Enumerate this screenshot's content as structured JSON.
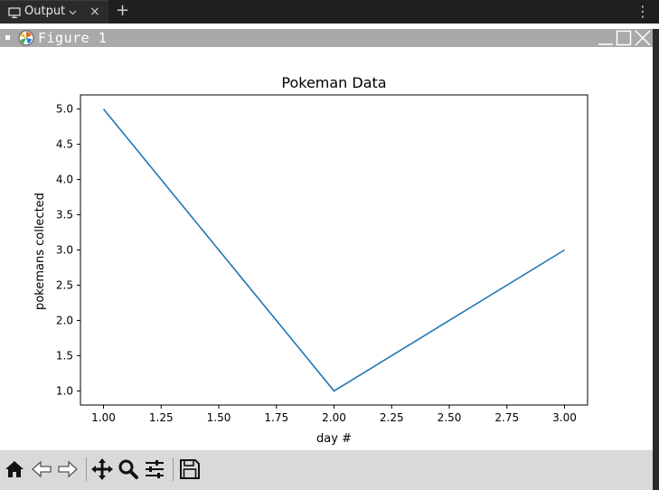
{
  "tab": {
    "label": "Output",
    "close_glyph": "×"
  },
  "tab_bar": {
    "new_tab_glyph": "+",
    "more_glyph": "⋮"
  },
  "window": {
    "title": "Figure 1"
  },
  "chart_data": {
    "type": "line",
    "title": "Pokeman Data",
    "xlabel": "day #",
    "ylabel": "pokemans collected",
    "x": [
      1,
      2,
      3
    ],
    "y": [
      5,
      1,
      3
    ],
    "xlim": [
      0.9,
      3.1
    ],
    "ylim": [
      0.8,
      5.2
    ],
    "xticks": [
      "1.00",
      "1.25",
      "1.50",
      "1.75",
      "2.00",
      "2.25",
      "2.50",
      "2.75",
      "3.00"
    ],
    "yticks": [
      "1.0",
      "1.5",
      "2.0",
      "2.5",
      "3.0",
      "3.5",
      "4.0",
      "4.5",
      "5.0"
    ],
    "grid": false,
    "line_color": "#1f77b4"
  },
  "toolbar": {
    "items": [
      "home-icon",
      "back-icon",
      "forward-icon",
      "pan-icon",
      "zoom-icon",
      "configure-subplots-icon",
      "save-icon"
    ]
  }
}
